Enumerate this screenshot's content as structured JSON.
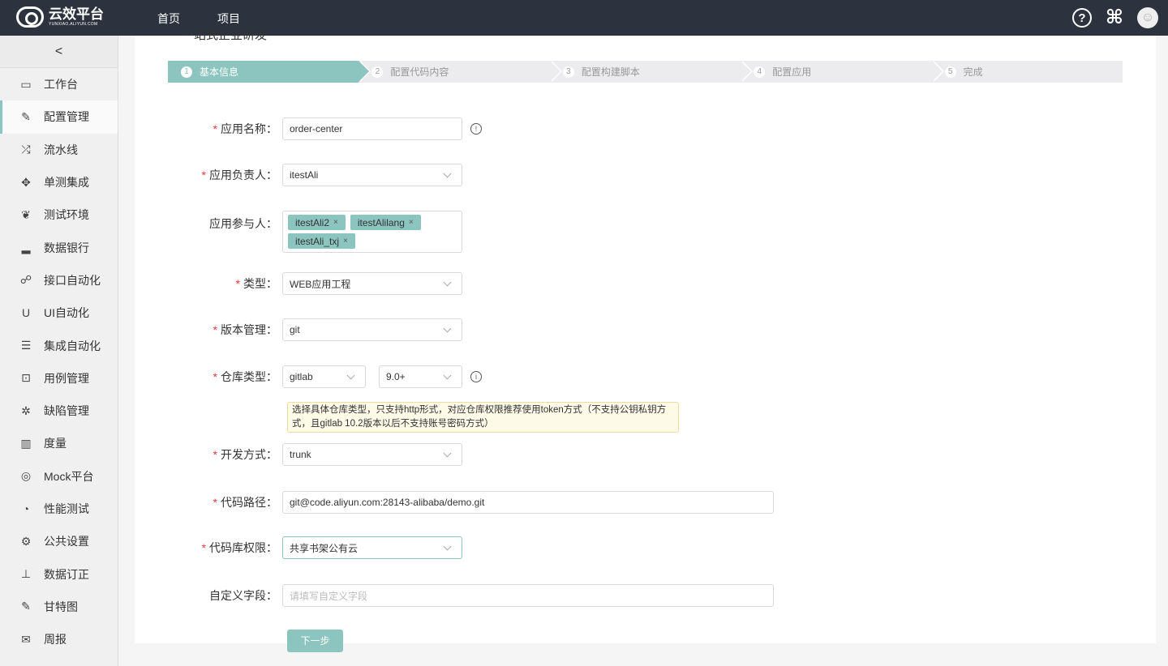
{
  "header": {
    "logo_title": "云效平台",
    "logo_sub": "YUNXIAO.ALIYUN.COM",
    "nav": [
      "首页",
      "项目"
    ],
    "icons": [
      "help-icon",
      "apps-icon",
      "avatar"
    ]
  },
  "sidebar": {
    "collapse": "<",
    "items": [
      {
        "label": "工作台",
        "icon": "monitor-icon",
        "glyph": "▭"
      },
      {
        "label": "配置管理",
        "icon": "wrench-icon",
        "glyph": "✎",
        "active": true
      },
      {
        "label": "流水线",
        "icon": "shuffle-icon",
        "glyph": "⤮"
      },
      {
        "label": "单测集成",
        "icon": "crosshair-icon",
        "glyph": "✥"
      },
      {
        "label": "测试环境",
        "icon": "leaf-icon",
        "glyph": "❦"
      },
      {
        "label": "数据银行",
        "icon": "signal-icon",
        "glyph": "▂"
      },
      {
        "label": "接口自动化",
        "icon": "sitemap-icon",
        "glyph": "☍"
      },
      {
        "label": "UI自动化",
        "icon": "magnet-icon",
        "glyph": "U"
      },
      {
        "label": "集成自动化",
        "icon": "server-icon",
        "glyph": "☰"
      },
      {
        "label": "用例管理",
        "icon": "inbox-icon",
        "glyph": "⊡"
      },
      {
        "label": "缺陷管理",
        "icon": "bug-icon",
        "glyph": "✲"
      },
      {
        "label": "度量",
        "icon": "bar-chart-icon",
        "glyph": "▥"
      },
      {
        "label": "Mock平台",
        "icon": "target-icon",
        "glyph": "◎"
      },
      {
        "label": "性能测试",
        "icon": "dashboard-icon",
        "glyph": "◔"
      },
      {
        "label": "公共设置",
        "icon": "gear-icon",
        "glyph": "⚙"
      },
      {
        "label": "数据订正",
        "icon": "pin-icon",
        "glyph": "⊥"
      },
      {
        "label": "甘特图",
        "icon": "wrench-icon",
        "glyph": "✎"
      },
      {
        "label": "周报",
        "icon": "envelope-icon",
        "glyph": "✉"
      }
    ]
  },
  "page": {
    "title": "一站式企业研发"
  },
  "steps": [
    {
      "num": "1",
      "label": "基本信息",
      "active": true
    },
    {
      "num": "2",
      "label": "配置代码内容"
    },
    {
      "num": "3",
      "label": "配置构建脚本"
    },
    {
      "num": "4",
      "label": "配置应用"
    },
    {
      "num": "5",
      "label": "完成"
    }
  ],
  "form": {
    "app_name": {
      "label": "应用名称",
      "value": "order-center"
    },
    "owner": {
      "label": "应用负责人",
      "value": "itestAli"
    },
    "participants": {
      "label": "应用参与人",
      "tags": [
        "itestAli2",
        "itestAlilang",
        "itestAli_txj"
      ]
    },
    "type": {
      "label": "类型",
      "value": "WEB应用工程"
    },
    "vcs": {
      "label": "版本管理",
      "value": "git"
    },
    "repo_type": {
      "label": "仓库类型",
      "value": "gitlab",
      "version": "9.0+",
      "tip": "选择具体仓库类型，只支持http形式，对应仓库权限推荐使用token方式（不支持公钥私钥方式，且gitlab 10.2版本以后不支持账号密码方式）"
    },
    "dev_mode": {
      "label": "开发方式",
      "value": "trunk"
    },
    "code_path": {
      "label": "代码路径",
      "value": "git@code.aliyun.com:28143-alibaba/demo.git"
    },
    "repo_perm": {
      "label": "代码库权限",
      "value": "共享书架公有云"
    },
    "custom": {
      "label": "自定义字段",
      "placeholder": "请填写自定义字段"
    },
    "colon": "：",
    "next": "下一步"
  },
  "colors": {
    "accent": "#8cc5bf",
    "header": "#2c333e",
    "required": "#e4393c"
  }
}
